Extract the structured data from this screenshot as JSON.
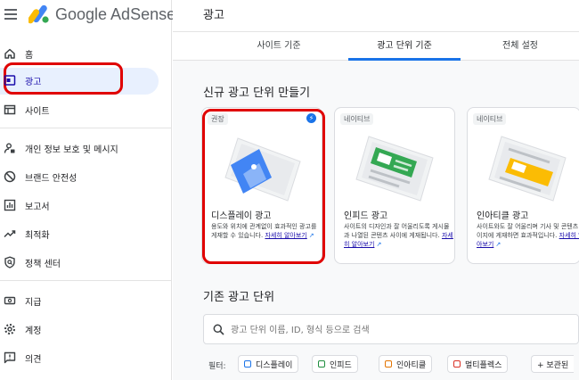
{
  "app": {
    "brand": "Google AdSense"
  },
  "sidebar": {
    "items": [
      {
        "label": "홈",
        "icon": "home-icon"
      },
      {
        "label": "광고",
        "icon": "ads-icon",
        "active": true
      },
      {
        "label": "사이트",
        "icon": "site-icon"
      },
      {
        "label": "개인 정보 보호 및 메시지",
        "icon": "privacy-icon"
      },
      {
        "label": "브랜드 안전성",
        "icon": "block-icon"
      },
      {
        "label": "보고서",
        "icon": "report-icon"
      },
      {
        "label": "최적화",
        "icon": "trending-icon"
      },
      {
        "label": "정책 센터",
        "icon": "policy-icon"
      },
      {
        "label": "지급",
        "icon": "payments-icon"
      },
      {
        "label": "계정",
        "icon": "gear-icon"
      },
      {
        "label": "의견",
        "icon": "feedback-icon"
      }
    ]
  },
  "header": {
    "title": "광고"
  },
  "tabs": [
    {
      "label": "사이트 기준"
    },
    {
      "label": "광고 단위 기준",
      "active": true
    },
    {
      "label": "전체 설정"
    }
  ],
  "new_section": {
    "title": "신규 광고 단위 만들기",
    "cards": [
      {
        "badge": "권장",
        "title": "디스플레이 광고",
        "desc": "용도와 위치에 관계없이 효과적인 광고를 게재할 수 있습니다.",
        "link": "자세히 알아보기"
      },
      {
        "badge": "네이티브",
        "title": "인피드 광고",
        "desc": "사이트의 디자인과 잘 어울리도록 게시물과 나열된 콘텐츠 사이에 게재됩니다.",
        "link": "자세히 알아보기"
      },
      {
        "badge": "네이티브",
        "title": "인아티클 광고",
        "desc": "사이트와도 잘 어울리며 기사 및 콘텐츠 페이지에 게재하면 효과적입니다.",
        "link": "자세히 알아보기"
      }
    ]
  },
  "existing_section": {
    "title": "기존 광고 단위",
    "search_placeholder": "광고 단위 이름, ID, 형식 등으로 검색",
    "filter_label": "필터:",
    "filters": [
      {
        "label": "디스플레이",
        "color": "#1a73e8"
      },
      {
        "label": "인피드",
        "color": "#1e8e3e"
      },
      {
        "label": "인아티클",
        "color": "#e37400"
      },
      {
        "label": "멀티플렉스",
        "color": "#d93025"
      },
      {
        "label": "+ 보관된"
      }
    ]
  },
  "colors": {
    "accent": "#1a73e8",
    "highlight": "#e00000",
    "active_nav": "#e8f0fe"
  }
}
